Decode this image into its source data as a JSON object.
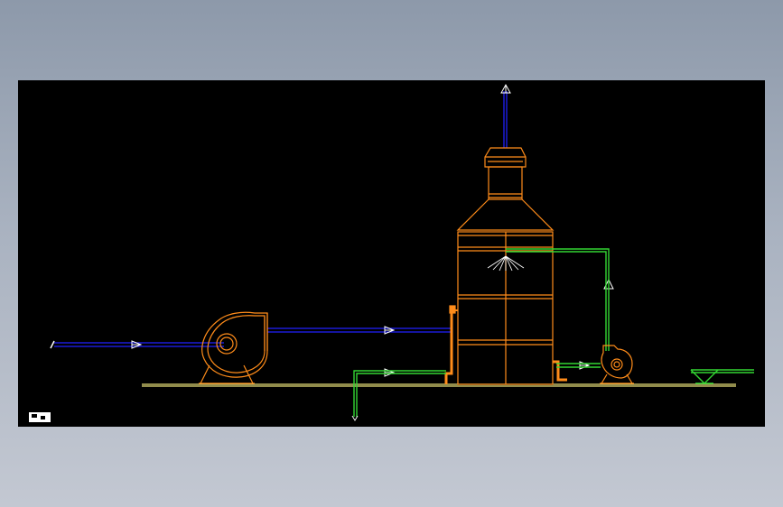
{
  "canvas": {
    "background": "#000000",
    "ucs_label": ""
  },
  "colors": {
    "equipment": "#ff8c1a",
    "air_duct": "#1a1ad6",
    "water_pipe": "#33d633",
    "ground_line": "#e8e07a",
    "arrow": "#ffffff"
  },
  "components": [
    {
      "name": "inlet-fan",
      "color_key": "equipment"
    },
    {
      "name": "scrubber-tower",
      "color_key": "equipment"
    },
    {
      "name": "circulation-pump",
      "color_key": "equipment"
    },
    {
      "name": "exhaust-stack",
      "color_key": "equipment"
    },
    {
      "name": "water-tank",
      "color_key": "water_pipe"
    }
  ],
  "flow_arrows": [
    {
      "name": "inlet-air-arrow",
      "direction": "right"
    },
    {
      "name": "duct-air-arrow",
      "direction": "right"
    },
    {
      "name": "exhaust-up-arrow",
      "direction": "up"
    },
    {
      "name": "water-in-arrow",
      "direction": "right"
    },
    {
      "name": "pump-in-arrow",
      "direction": "right"
    },
    {
      "name": "water-up-arrow",
      "direction": "up"
    }
  ]
}
